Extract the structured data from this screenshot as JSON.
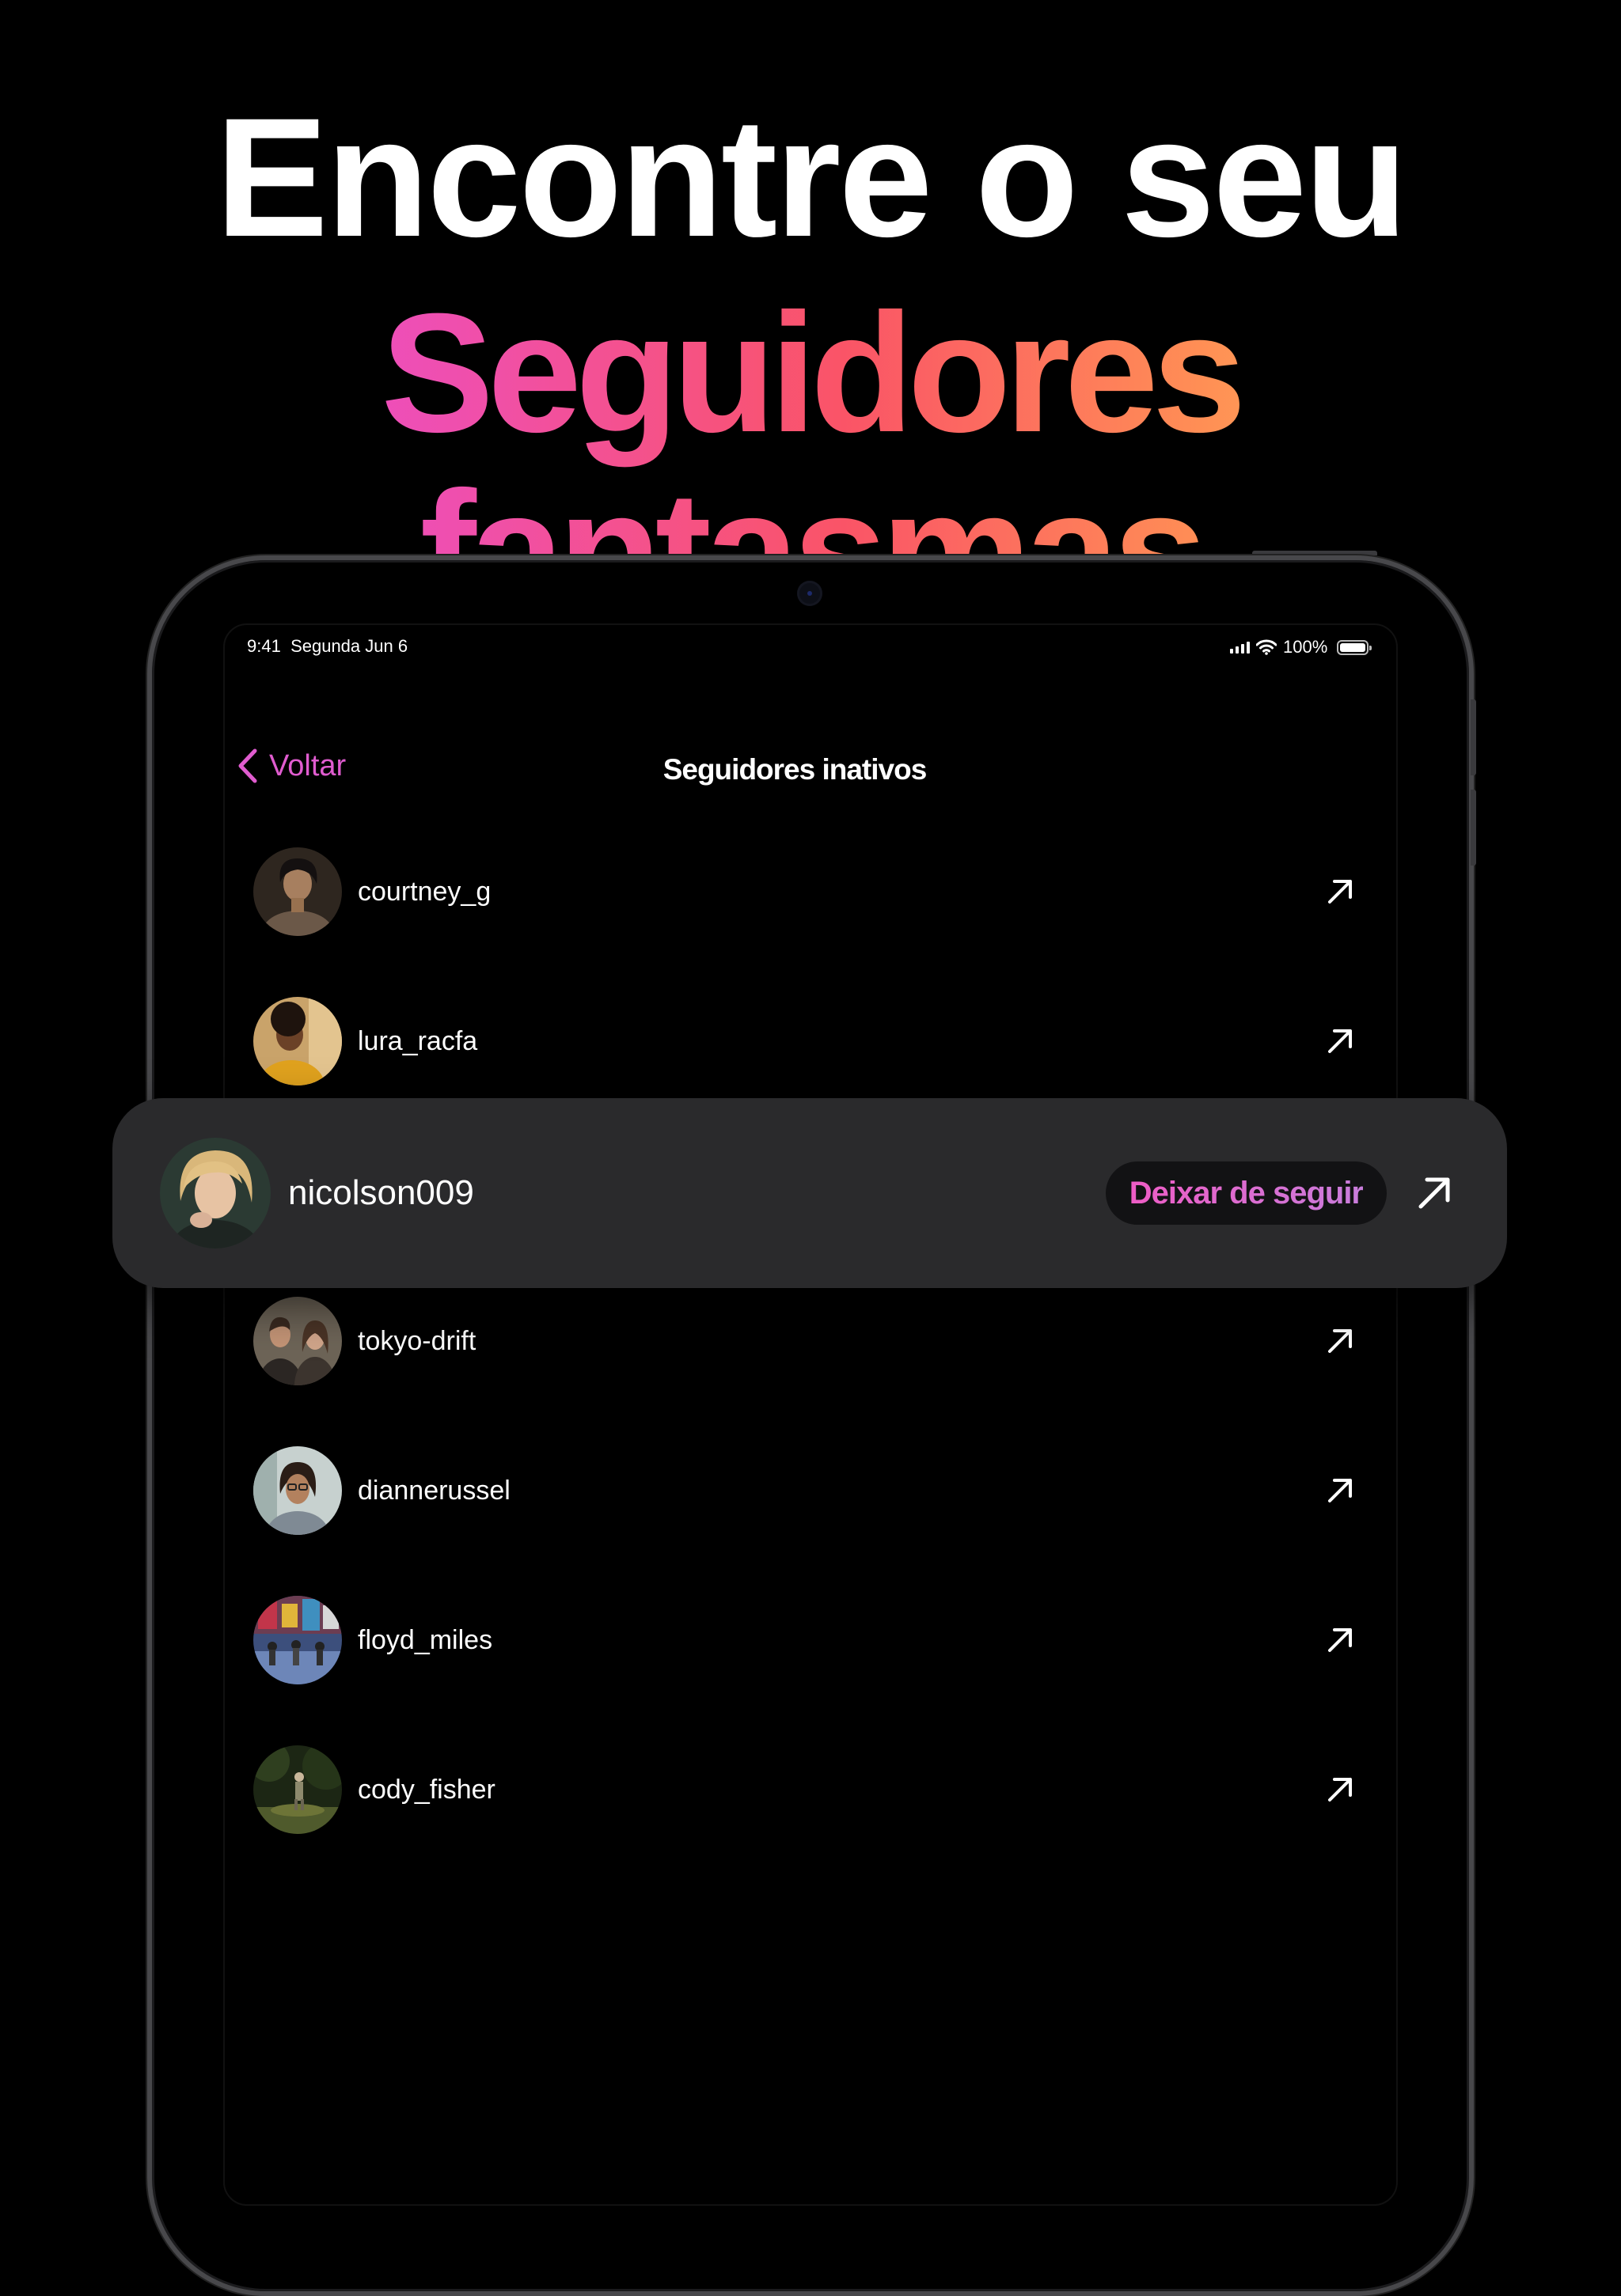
{
  "headline": {
    "line1": "Encontre o seu",
    "line2": "Seguidores fantasmas"
  },
  "colors": {
    "background": "#000000",
    "accent": "#e05ccf",
    "gradient": [
      "#e74cf2",
      "#fa5467",
      "#ff8e55",
      "#ffd95a"
    ],
    "card": "#2a2a2c"
  },
  "status_bar": {
    "time": "9:41",
    "date": "Segunda Jun 6",
    "battery": "100%",
    "icons": [
      "signal-icon",
      "wifi-icon",
      "battery-icon"
    ]
  },
  "nav": {
    "back_label": "Voltar",
    "back_icon": "chevron-left-icon",
    "title": "Seguidores inativos"
  },
  "list": {
    "rows": [
      {
        "username": "courtney_g",
        "icon": "arrow-up-right-icon"
      },
      {
        "username": "lura_racfa",
        "icon": "arrow-up-right-icon"
      },
      {
        "username": "tokyo-drift",
        "icon": "arrow-up-right-icon"
      },
      {
        "username": "diannerussel",
        "icon": "arrow-up-right-icon"
      },
      {
        "username": "floyd_miles",
        "icon": "arrow-up-right-icon"
      },
      {
        "username": "cody_fisher",
        "icon": "arrow-up-right-icon"
      }
    ]
  },
  "highlight": {
    "username": "nicolson009",
    "action_label": "Deixar de seguir",
    "icon": "arrow-up-right-icon"
  }
}
